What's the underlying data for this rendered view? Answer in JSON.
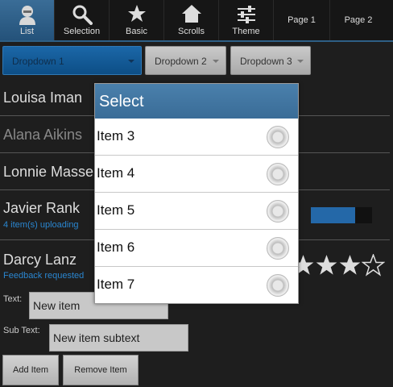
{
  "tabs": [
    {
      "label": "List",
      "icon": "person-icon",
      "active": true
    },
    {
      "label": "Selection",
      "icon": "search-icon",
      "active": false
    },
    {
      "label": "Basic",
      "icon": "star-icon",
      "active": false
    },
    {
      "label": "Scrolls",
      "icon": "home-icon",
      "active": false
    },
    {
      "label": "Theme",
      "icon": "sliders-icon",
      "active": false
    },
    {
      "label": "Page 1",
      "active": false
    },
    {
      "label": "Page 2",
      "active": false
    }
  ],
  "dropdowns": [
    {
      "label": "Dropdown 1",
      "active": true
    },
    {
      "label": "Dropdown 2",
      "active": false
    },
    {
      "label": "Dropdown 3",
      "active": false
    }
  ],
  "list": [
    {
      "name": "Louisa Iman"
    },
    {
      "name": "Alana Aikins",
      "dimmed": true
    },
    {
      "name": "Lonnie Masse"
    },
    {
      "name": "Javier Rank",
      "sub": "4 item(s) uploading",
      "progress": 0.72
    },
    {
      "name": "Darcy Lanz",
      "sub": "Feedback requested",
      "rating": 3,
      "rating_max": 4
    }
  ],
  "form": {
    "text_label": "Text:",
    "text_value": "New item",
    "subtext_label": "Sub Text:",
    "subtext_value": "New item subtext",
    "add_label": "Add Item",
    "remove_label": "Remove Item"
  },
  "popup": {
    "title": "Select",
    "items": [
      "Item 3",
      "Item 4",
      "Item 5",
      "Item 6",
      "Item 7"
    ]
  },
  "colors": {
    "accent": "#2c5a80",
    "progress": "#2468a8",
    "link": "#2a86d0"
  }
}
